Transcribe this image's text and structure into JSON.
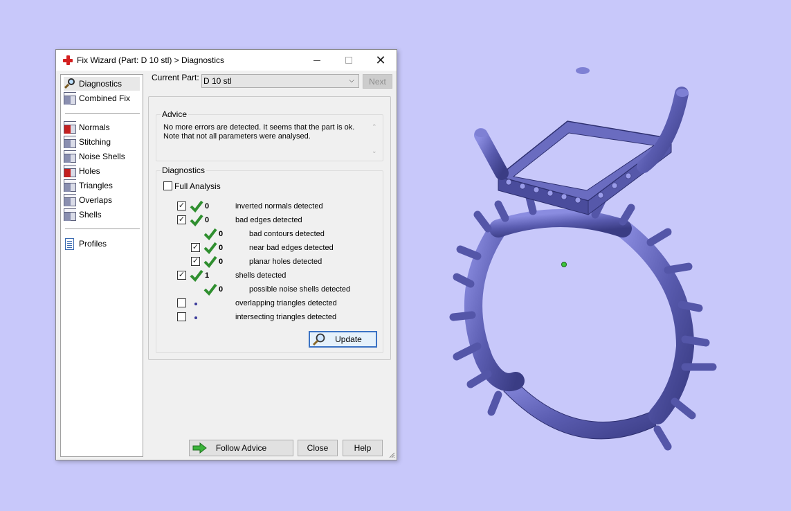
{
  "window": {
    "title": "Fix Wizard (Part: D 10 stl) > Diagnostics",
    "minimize_glyph": "",
    "close_glyph": "✕"
  },
  "sidebar": {
    "items": [
      {
        "label": "Diagnostics",
        "icon": "magnifier-icon"
      },
      {
        "label": "Combined Fix",
        "icon": "cube-icon"
      },
      {
        "label": "Normals",
        "icon": "normals-icon"
      },
      {
        "label": "Stitching",
        "icon": "stitching-icon"
      },
      {
        "label": "Noise Shells",
        "icon": "noise-shells-icon"
      },
      {
        "label": "Holes",
        "icon": "holes-icon"
      },
      {
        "label": "Triangles",
        "icon": "triangles-icon"
      },
      {
        "label": "Overlaps",
        "icon": "overlaps-icon"
      },
      {
        "label": "Shells",
        "icon": "shells-icon"
      },
      {
        "label": "Profiles",
        "icon": "document-icon"
      }
    ]
  },
  "current_part": {
    "label": "Current Part:",
    "value": "D 10 stl"
  },
  "buttons": {
    "next": "Next",
    "update": "Update",
    "follow_advice": "Follow Advice",
    "close": "Close",
    "help": "Help"
  },
  "advice": {
    "title": "Advice",
    "line1": "No more errors are detected. It seems that the part is ok.",
    "line2": "Note that not all parameters were analysed."
  },
  "diagnostics": {
    "title": "Diagnostics",
    "full_analysis_label": "Full Analysis",
    "rows": [
      {
        "count": "0",
        "label": "inverted normals detected"
      },
      {
        "count": "0",
        "label": "bad edges detected"
      },
      {
        "count": "0",
        "label": "bad contours detected"
      },
      {
        "count": "0",
        "label": "near bad edges detected"
      },
      {
        "count": "0",
        "label": "planar holes detected"
      },
      {
        "count": "1",
        "label": "shells detected"
      },
      {
        "count": "0",
        "label": "possible noise shells detected"
      },
      {
        "count": "",
        "label": "overlapping triangles detected"
      },
      {
        "count": "",
        "label": "intersecting triangles detected"
      }
    ]
  },
  "colors": {
    "background": "#c8c8fa",
    "model": "#5a5cb0",
    "check_green": "#2f8f2f"
  }
}
